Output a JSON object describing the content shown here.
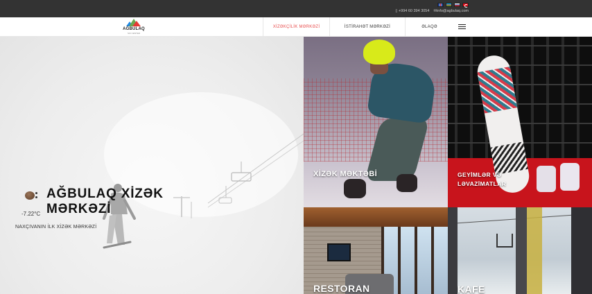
{
  "topbar": {
    "languages": [
      "en",
      "az",
      "ru",
      "tr"
    ],
    "phone": "+994 60 394 3054",
    "email": "info@agbulaq.com"
  },
  "navbar": {
    "logo_text": "AĞBULAQ",
    "logo_sub": "SKI CENTER",
    "links": [
      {
        "label": "XİZƏKÇİLİK MƏRKƏZİ",
        "active": true
      },
      {
        "label": "İSTİRAHƏT MƏRKƏZİ",
        "active": false
      },
      {
        "label": "ƏLAQƏ",
        "active": false
      }
    ],
    "menu_icon": "hamburger-menu-icon",
    "accent_color": "#e84c4c"
  },
  "hero": {
    "weather_icon": "weather-icon",
    "temperature": "-7.22°C",
    "title_line1": "AĞBULAQ XİZƏK",
    "title_line2": "MƏRKƏZİ",
    "subtitle": "NAXÇIVANIN İLK XİZƏK MƏRKƏZİ"
  },
  "tiles": [
    {
      "label": "XİZƏK MƏKTƏBİ"
    },
    {
      "label_line1": "GEYİMLƏR VƏ",
      "label_line2": "LƏVAZİMATLAR"
    },
    {
      "label": "RESTORAN"
    },
    {
      "label": "KAFE"
    }
  ]
}
